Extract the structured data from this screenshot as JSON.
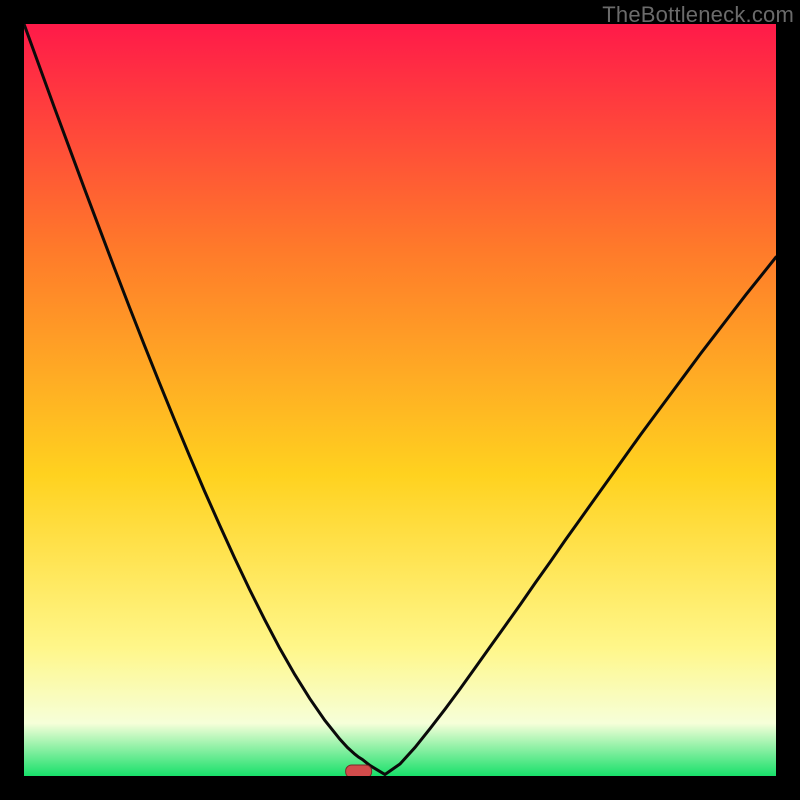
{
  "watermark": "TheBottleneck.com",
  "colors": {
    "page_bg": "#000000",
    "gradient_top": "#ff1a49",
    "gradient_mid_upper": "#ff7a2a",
    "gradient_mid": "#ffd21f",
    "gradient_lower": "#fff78a",
    "gradient_band": "#f6ffd9",
    "gradient_bottom": "#18e06a",
    "curve": "#0a0a0a",
    "marker_fill": "#d24b4b",
    "marker_stroke": "#7a2a2a"
  },
  "chart_data": {
    "type": "line",
    "title": "",
    "xlabel": "",
    "ylabel": "",
    "xlim": [
      0,
      100
    ],
    "ylim": [
      0,
      100
    ],
    "x": [
      0,
      2,
      4,
      6,
      8,
      10,
      12,
      14,
      16,
      18,
      20,
      22,
      24,
      26,
      28,
      30,
      32,
      34,
      36,
      38,
      40,
      42,
      43,
      44,
      44.5,
      45,
      46,
      48,
      50,
      52,
      54,
      56,
      58,
      60,
      62,
      64,
      66,
      68,
      70,
      72,
      74,
      76,
      78,
      80,
      82,
      84,
      86,
      88,
      90,
      92,
      94,
      96,
      98,
      100
    ],
    "values": [
      100,
      94.5,
      89,
      83.6,
      78.2,
      72.9,
      67.6,
      62.4,
      57.3,
      52.3,
      47.4,
      42.6,
      37.9,
      33.4,
      29.0,
      24.8,
      20.8,
      17.0,
      13.5,
      10.3,
      7.4,
      4.9,
      3.8,
      2.9,
      2.5,
      2.2,
      1.4,
      0.2,
      1.6,
      3.8,
      6.3,
      8.9,
      11.6,
      14.4,
      17.2,
      20.0,
      22.8,
      25.7,
      28.5,
      31.4,
      34.2,
      37.0,
      39.8,
      42.6,
      45.4,
      48.1,
      50.8,
      53.5,
      56.2,
      58.8,
      61.4,
      64.0,
      66.5,
      69.0
    ],
    "marker": {
      "x": 44.5,
      "y": 0,
      "shape": "rounded-pill"
    },
    "bottleneck_min_x": 44.5,
    "bottleneck_min_y": 0
  }
}
